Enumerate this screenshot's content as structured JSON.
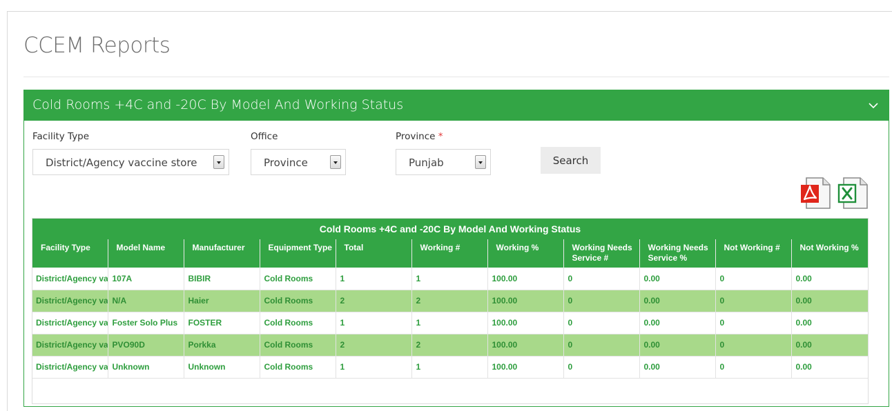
{
  "page": {
    "title": "CCEM Reports"
  },
  "panel": {
    "title": "Cold Rooms +4C and -20C By Model And Working Status"
  },
  "filters": {
    "facility_type": {
      "label": "Facility Type",
      "value": "District/Agency vaccine store"
    },
    "office": {
      "label": "Office",
      "value": "Province"
    },
    "province": {
      "label": "Province",
      "required_marker": "*",
      "value": "Punjab"
    },
    "search_label": "Search"
  },
  "exports": {
    "pdf": "pdf-icon",
    "excel": "excel-icon"
  },
  "grid": {
    "caption": "Cold Rooms +4C and -20C By Model And Working Status",
    "columns": [
      "Facility Type",
      "Model Name",
      "Manufacturer",
      "Equipment Type",
      "Total",
      "Working #",
      "Working %",
      "Working Needs Service #",
      "Working Needs Service %",
      "Not Working #",
      "Not Working %"
    ],
    "rows": [
      [
        "District/Agency vaccine store",
        "107A",
        "BIBIR",
        "Cold Rooms",
        "1",
        "1",
        "100.00",
        "0",
        "0.00",
        "0",
        "0.00"
      ],
      [
        "District/Agency vaccine store",
        "N/A",
        "Haier",
        "Cold Rooms",
        "2",
        "2",
        "100.00",
        "0",
        "0.00",
        "0",
        "0.00"
      ],
      [
        "District/Agency vaccine store",
        "Foster Solo Plus",
        "FOSTER",
        "Cold Rooms",
        "1",
        "1",
        "100.00",
        "0",
        "0.00",
        "0",
        "0.00"
      ],
      [
        "District/Agency vaccine store",
        "PVO90D",
        "Porkka",
        "Cold Rooms",
        "2",
        "2",
        "100.00",
        "0",
        "0.00",
        "0",
        "0.00"
      ],
      [
        "District/Agency vaccine store",
        "Unknown",
        "Unknown",
        "Cold Rooms",
        "1",
        "1",
        "100.00",
        "0",
        "0.00",
        "0",
        "0.00"
      ]
    ]
  },
  "colors": {
    "accent": "#33a545",
    "row_alt": "#a8d98a",
    "cell_text": "#2e9e3e"
  }
}
